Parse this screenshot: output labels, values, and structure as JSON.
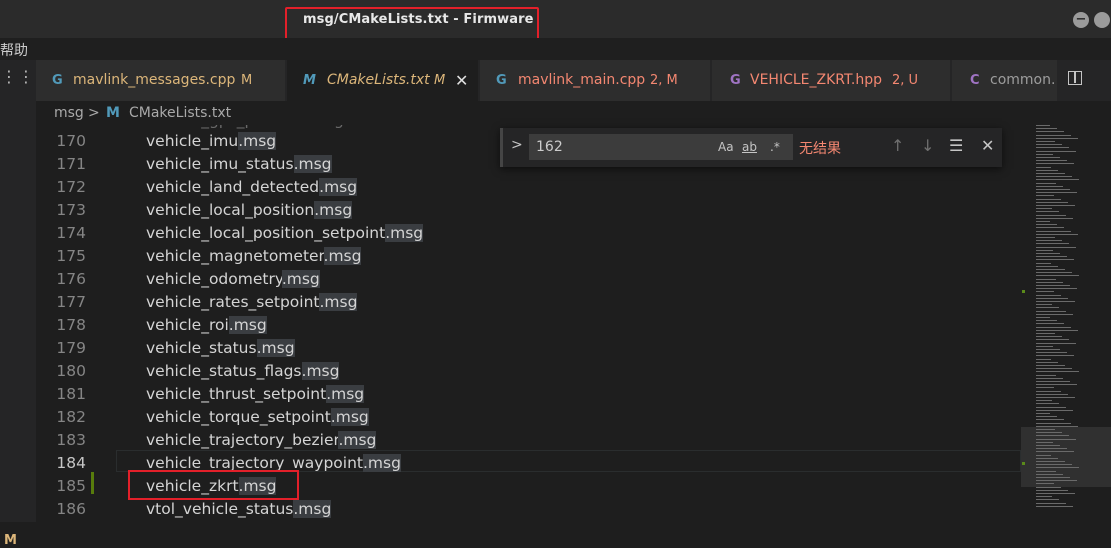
{
  "window": {
    "title": "msg/CMakeLists.txt - Firmware"
  },
  "menu": {
    "help": "帮助"
  },
  "tabs": [
    {
      "icon": "G",
      "label": "mavlink_messages.cpp",
      "status": "M",
      "active": false,
      "icon_color": "#519aba",
      "label_color": "#dcb67a"
    },
    {
      "icon": "M",
      "label": "CMakeLists.txt",
      "status": "M",
      "active": true,
      "icon_color": "#519aba",
      "label_color": "#dcb67a"
    },
    {
      "icon": "G",
      "label": "mavlink_main.cpp",
      "status": "2, M",
      "active": false,
      "icon_color": "#519aba",
      "label_color": "#f48771"
    },
    {
      "icon": "G",
      "label": "VEHICLE_ZKRT.hpp",
      "status": "2, U",
      "active": false,
      "icon_color": "#a074c4",
      "label_color": "#f48771"
    },
    {
      "icon": "C",
      "label": "common.",
      "status": "",
      "active": false,
      "icon_color": "#a074c4",
      "label_color": "#9d9d9d"
    }
  ],
  "breadcrumb": {
    "folder": "msg",
    "separator": ">",
    "file_icon": "M",
    "file": "CMakeLists.txt"
  },
  "find": {
    "value": "162",
    "match_case": "Aa",
    "whole_word": "ab",
    "regex": ".*",
    "result": "无结果"
  },
  "editor": {
    "lines": [
      {
        "num": "170",
        "base": "vehicle_imu",
        "ext": ".msg"
      },
      {
        "num": "171",
        "base": "vehicle_imu_status",
        "ext": ".msg"
      },
      {
        "num": "172",
        "base": "vehicle_land_detected",
        "ext": ".msg"
      },
      {
        "num": "173",
        "base": "vehicle_local_position",
        "ext": ".msg"
      },
      {
        "num": "174",
        "base": "vehicle_local_position_setpoint",
        "ext": ".msg"
      },
      {
        "num": "175",
        "base": "vehicle_magnetometer",
        "ext": ".msg"
      },
      {
        "num": "176",
        "base": "vehicle_odometry",
        "ext": ".msg"
      },
      {
        "num": "177",
        "base": "vehicle_rates_setpoint",
        "ext": ".msg"
      },
      {
        "num": "178",
        "base": "vehicle_roi",
        "ext": ".msg"
      },
      {
        "num": "179",
        "base": "vehicle_status",
        "ext": ".msg"
      },
      {
        "num": "180",
        "base": "vehicle_status_flags",
        "ext": ".msg"
      },
      {
        "num": "181",
        "base": "vehicle_thrust_setpoint",
        "ext": ".msg"
      },
      {
        "num": "182",
        "base": "vehicle_torque_setpoint",
        "ext": ".msg"
      },
      {
        "num": "183",
        "base": "vehicle_trajectory_bezier",
        "ext": ".msg"
      },
      {
        "num": "184",
        "base": "vehicle_trajectory_waypoint",
        "ext": ".msg"
      },
      {
        "num": "185",
        "base": "vehicle_zkrt",
        "ext": ".msg"
      },
      {
        "num": "186",
        "base": "vtol_vehicle_status",
        "ext": ".msg"
      }
    ],
    "current_line": "184",
    "modified_line": "185"
  },
  "gutter": {
    "scm_badge": "M"
  }
}
